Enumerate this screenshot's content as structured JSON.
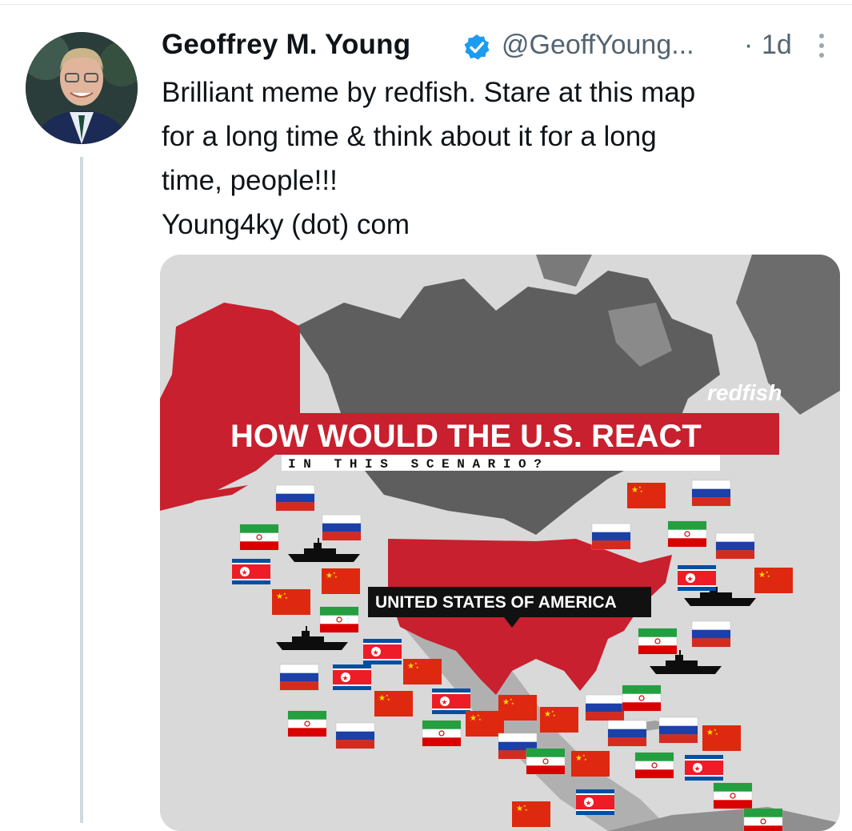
{
  "tweet": {
    "display_name": "Geoffrey M. Young",
    "handle": "@GeoffYoung...",
    "separator": "·",
    "time": "1d",
    "text_lines": [
      "Brilliant meme by redfish. Stare at this map",
      "for a long time & think about it for a long",
      "time, people!!!",
      "Young4ky (dot) com"
    ]
  },
  "image": {
    "brand": "redfish",
    "headline": "HOW WOULD THE U.S. REACT",
    "subheadline": "I N   T H I S   S C E N A R I O ?",
    "country_label": "UNITED STATES OF AMERICA"
  },
  "colors": {
    "verified_blue": "#1d9bf0",
    "meme_red": "#c8202e",
    "secondary_text": "#536471"
  }
}
